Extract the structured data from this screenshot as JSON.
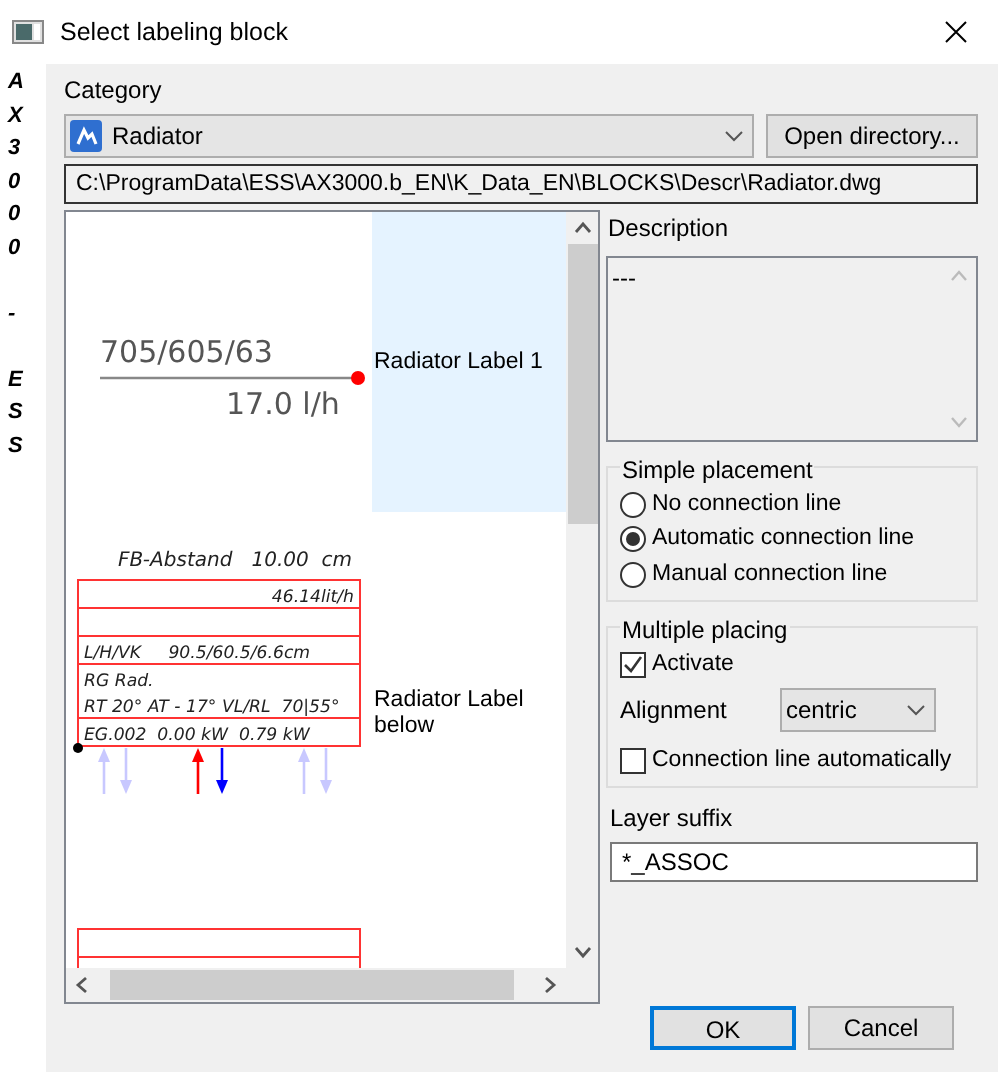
{
  "window": {
    "title": "Select labeling block"
  },
  "side_label": "AX3000 - ESS",
  "category": {
    "label": "Category",
    "value": "Radiator"
  },
  "open_directory_button": "Open directory...",
  "path": "C:\\ProgramData\\ESS\\AX3000.b_EN\\K_Data_EN\\BLOCKS\\Descr\\Radiator.dwg",
  "blocks": [
    {
      "label": "Radiator Label 1",
      "selected": true,
      "preview": {
        "kind": "leader",
        "lines": [
          "705/605/63",
          "17.0 l/h"
        ]
      }
    },
    {
      "label": "Radiator Label below",
      "selected": false,
      "preview": {
        "kind": "table",
        "heading": "FB-Abstand   10.00  cm",
        "rows": [
          [
            "46.14lit/h"
          ],
          [],
          [
            "L/H/VK     90.5/60.5/6.6cm"
          ],
          [
            "RG Rad.",
            "RT 20° AT - 17° VL/RL  70|55°"
          ],
          [
            "EG.002  0.00 kW  0.79 kW"
          ]
        ]
      }
    },
    {
      "selected": false,
      "preview": {
        "kind": "table_top"
      }
    }
  ],
  "description": {
    "label": "Description",
    "value": "---"
  },
  "simple_placement": {
    "title": "Simple placement",
    "options": [
      {
        "label": "No connection line",
        "selected": false
      },
      {
        "label": "Automatic connection line",
        "selected": true
      },
      {
        "label": "Manual connection line",
        "selected": false
      }
    ]
  },
  "multiple_placing": {
    "title": "Multiple placing",
    "activate": {
      "label": "Activate",
      "checked": true
    },
    "alignment": {
      "label": "Alignment",
      "value": "centric"
    },
    "connection_line": {
      "label": "Connection line automatically",
      "checked": false
    }
  },
  "layer_suffix": {
    "label": "Layer suffix",
    "value": "*_ASSOC"
  },
  "buttons": [
    {
      "label": "OK",
      "default": true
    },
    {
      "label": "Cancel",
      "default": false
    }
  ]
}
